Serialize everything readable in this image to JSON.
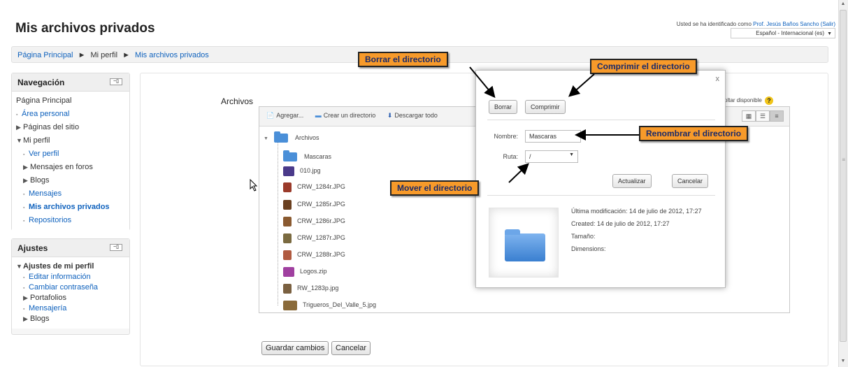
{
  "header": {
    "title": "Mis archivos privados",
    "login_prefix": "Usted se ha identificado como",
    "user_name": "Prof. Jesús Baños Sancho",
    "logout": "(Salir)",
    "language": "Español - Internacional (es)"
  },
  "breadcrumb": {
    "items": [
      "Página Principal",
      "Mi perfil",
      "Mis archivos privados"
    ]
  },
  "navigation": {
    "title": "Navegación",
    "items": [
      {
        "label": "Página Principal"
      },
      {
        "label": "Área personal"
      },
      {
        "label": "Páginas del sitio"
      },
      {
        "label": "Mi perfil"
      },
      {
        "label": "Ver perfil"
      },
      {
        "label": "Mensajes en foros"
      },
      {
        "label": "Blogs"
      },
      {
        "label": "Mensajes"
      },
      {
        "label": "Mis archivos privados"
      },
      {
        "label": "Repositorios"
      }
    ]
  },
  "settings": {
    "title": "Ajustes",
    "items": [
      {
        "label": "Ajustes de mi perfil"
      },
      {
        "label": "Editar información"
      },
      {
        "label": "Cambiar contraseña"
      },
      {
        "label": "Portafolios"
      },
      {
        "label": "Mensajería"
      },
      {
        "label": "Blogs"
      }
    ]
  },
  "main": {
    "files_label": "Archivos",
    "max_size_text": "oltar disponible"
  },
  "filemanager": {
    "toolbar": {
      "add": "Agregar...",
      "create_dir": "Crear un directorio",
      "download_all": "Descargar todo"
    },
    "tree": {
      "root": "Archivos",
      "items": [
        {
          "name": "Mascaras",
          "kind": "folder"
        },
        {
          "name": "010.jpg",
          "kind": "image"
        },
        {
          "name": "CRW_1284r.JPG",
          "kind": "image"
        },
        {
          "name": "CRW_1285r.JPG",
          "kind": "image"
        },
        {
          "name": "CRW_1286r.JPG",
          "kind": "image"
        },
        {
          "name": "CRW_1287r.JPG",
          "kind": "image"
        },
        {
          "name": "CRW_1288r.JPG",
          "kind": "image"
        },
        {
          "name": "Logos.zip",
          "kind": "zip"
        },
        {
          "name": "RW_1283p.jpg",
          "kind": "image"
        },
        {
          "name": "Trigueros_Del_Valle_5.jpg",
          "kind": "image"
        }
      ]
    }
  },
  "dialog": {
    "delete_button": "Borrar",
    "zip_button": "Comprimir",
    "name_label": "Nombre:",
    "name_value": "Mascaras",
    "path_label": "Ruta:",
    "path_value": "/",
    "update_button": "Actualizar",
    "cancel_button": "Cancelar",
    "close": "x",
    "info": {
      "modified": "Última modificación: 14 de julio de 2012, 17:27",
      "created": "Created: 14 de julio de 2012, 17:27",
      "size": "Tamaño:",
      "dimensions": "Dimensions:"
    }
  },
  "callouts": {
    "delete_dir": "Borrar el directorio",
    "zip_dir": "Comprimir el directorio",
    "rename_dir": "Renombrar el directorio",
    "move_dir": "Mover el directorio"
  },
  "footer": {
    "save": "Guardar cambios",
    "cancel": "Cancelar"
  },
  "colors": {
    "link": "#0e61bd",
    "callout_bg": "#f79a2a",
    "folder": "#4a8fd8"
  }
}
